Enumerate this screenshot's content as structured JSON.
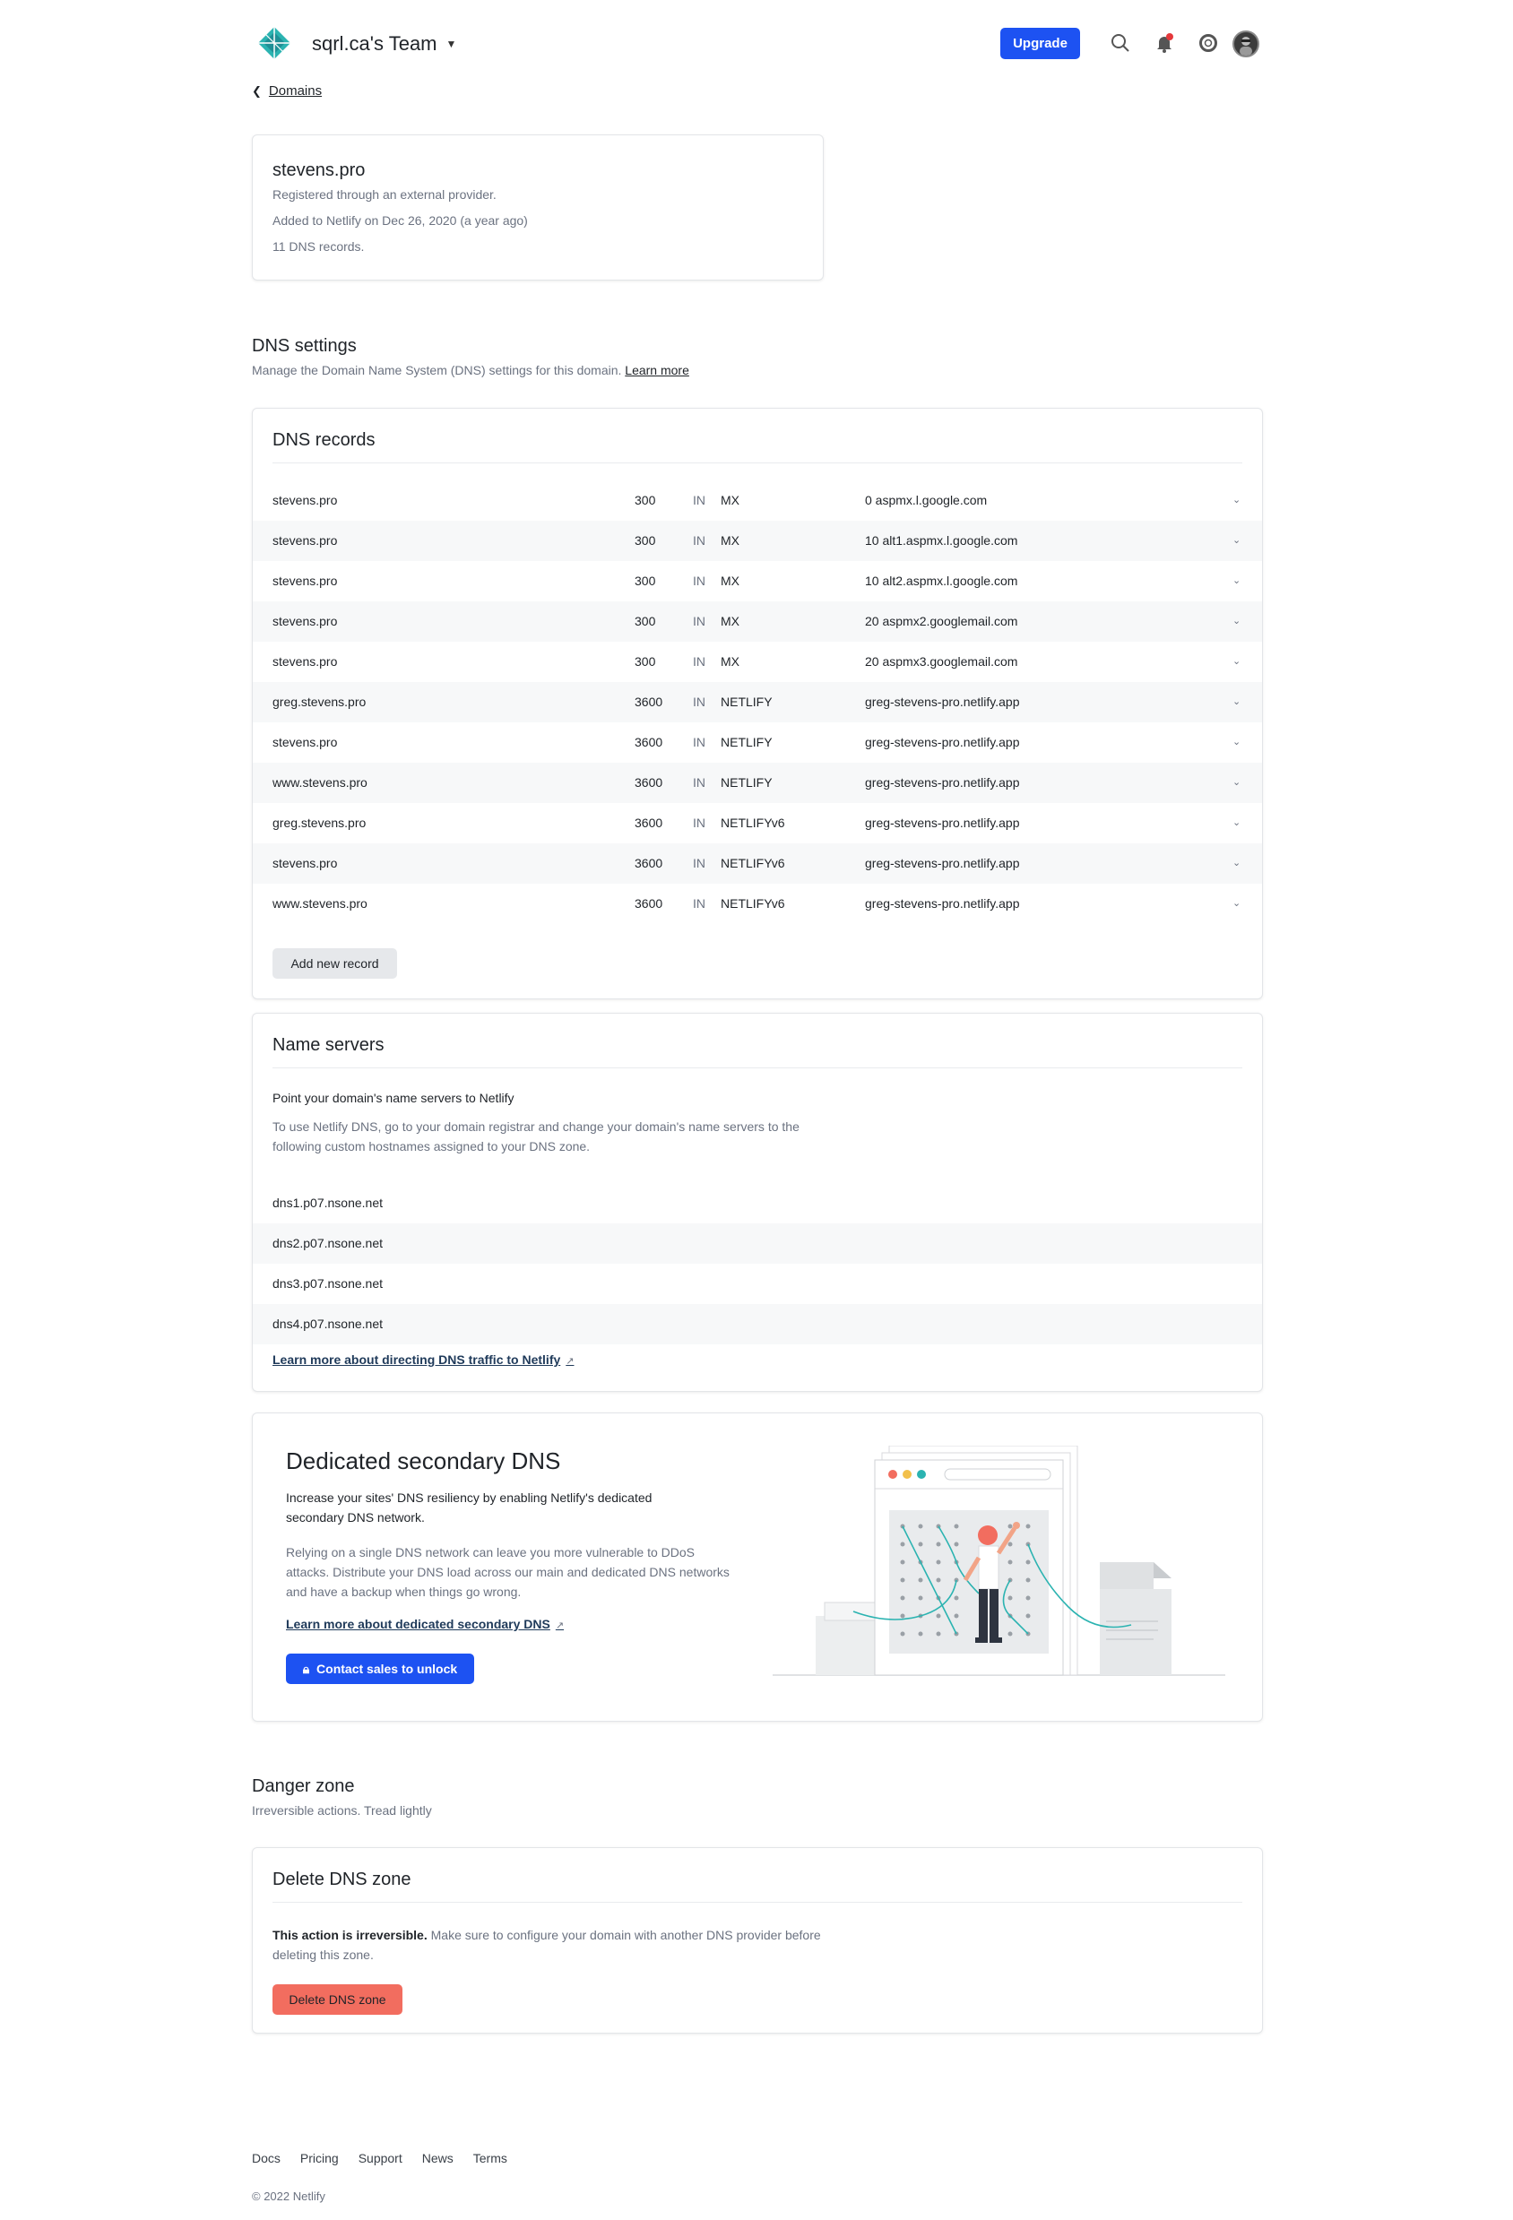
{
  "header": {
    "team_name": "sqrl.ca's Team",
    "upgrade_label": "Upgrade"
  },
  "breadcrumb": {
    "back_label": "Domains"
  },
  "domain": {
    "name": "stevens.pro",
    "registered": "Registered through an external provider.",
    "added": "Added to Netlify on Dec 26, 2020 (a year ago)",
    "records_count": "11 DNS records."
  },
  "dns_settings": {
    "title": "DNS settings",
    "subtitle": "Manage the Domain Name System (DNS) settings for this domain.",
    "learn_more": "Learn more"
  },
  "dns_records": {
    "title": "DNS records",
    "rows": [
      {
        "name": "stevens.pro",
        "ttl": "300",
        "class": "IN",
        "type": "MX",
        "value": "0 aspmx.l.google.com"
      },
      {
        "name": "stevens.pro",
        "ttl": "300",
        "class": "IN",
        "type": "MX",
        "value": "10 alt1.aspmx.l.google.com"
      },
      {
        "name": "stevens.pro",
        "ttl": "300",
        "class": "IN",
        "type": "MX",
        "value": "10 alt2.aspmx.l.google.com"
      },
      {
        "name": "stevens.pro",
        "ttl": "300",
        "class": "IN",
        "type": "MX",
        "value": "20 aspmx2.googlemail.com"
      },
      {
        "name": "stevens.pro",
        "ttl": "300",
        "class": "IN",
        "type": "MX",
        "value": "20 aspmx3.googlemail.com"
      },
      {
        "name": "greg.stevens.pro",
        "ttl": "3600",
        "class": "IN",
        "type": "NETLIFY",
        "value": "greg-stevens-pro.netlify.app"
      },
      {
        "name": "stevens.pro",
        "ttl": "3600",
        "class": "IN",
        "type": "NETLIFY",
        "value": "greg-stevens-pro.netlify.app"
      },
      {
        "name": "www.stevens.pro",
        "ttl": "3600",
        "class": "IN",
        "type": "NETLIFY",
        "value": "greg-stevens-pro.netlify.app"
      },
      {
        "name": "greg.stevens.pro",
        "ttl": "3600",
        "class": "IN",
        "type": "NETLIFYv6",
        "value": "greg-stevens-pro.netlify.app"
      },
      {
        "name": "stevens.pro",
        "ttl": "3600",
        "class": "IN",
        "type": "NETLIFYv6",
        "value": "greg-stevens-pro.netlify.app"
      },
      {
        "name": "www.stevens.pro",
        "ttl": "3600",
        "class": "IN",
        "type": "NETLIFYv6",
        "value": "greg-stevens-pro.netlify.app"
      }
    ],
    "add_label": "Add new record"
  },
  "name_servers": {
    "title": "Name servers",
    "heading": "Point your domain's name servers to Netlify",
    "description": "To use Netlify DNS, go to your domain registrar and change your domain's name servers to the following custom hostnames assigned to your DNS zone.",
    "servers": [
      "dns1.p07.nsone.net",
      "dns2.p07.nsone.net",
      "dns3.p07.nsone.net",
      "dns4.p07.nsone.net"
    ],
    "link": "Learn more about directing DNS traffic to Netlify"
  },
  "secondary_dns": {
    "title": "Dedicated secondary DNS",
    "lead": "Increase your sites' DNS resiliency by enabling Netlify's dedicated secondary DNS network.",
    "description": "Relying on a single DNS network can leave you more vulnerable to DDoS attacks. Distribute your DNS load across our main and dedicated DNS networks and have a backup when things go wrong.",
    "link": "Learn more about dedicated secondary DNS",
    "button": "Contact sales to unlock"
  },
  "danger_zone": {
    "title": "Danger zone",
    "subtitle": "Irreversible actions. Tread lightly",
    "card_title": "Delete DNS zone",
    "warning_bold": "This action is irreversible.",
    "warning_rest": " Make sure to configure your domain with another DNS provider before deleting this zone.",
    "button": "Delete DNS zone"
  },
  "footer": {
    "links": [
      "Docs",
      "Pricing",
      "Support",
      "News",
      "Terms"
    ],
    "copyright": "© 2022 Netlify"
  },
  "colors": {
    "primary": "#1d52f2",
    "danger": "#f26d5f",
    "accent_teal": "#2bb3b1"
  }
}
